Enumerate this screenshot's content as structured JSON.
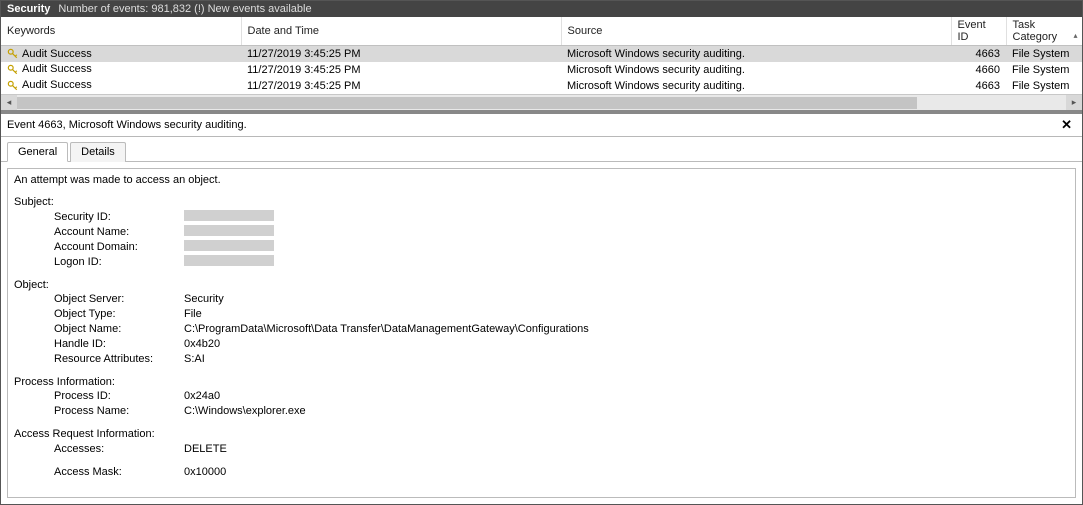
{
  "titlebar": {
    "section": "Security",
    "count_text": "Number of events: 981,832 (!) New events available"
  },
  "columns": {
    "keywords": "Keywords",
    "datetime": "Date and Time",
    "source": "Source",
    "eventid": "Event ID",
    "taskcat": "Task Category"
  },
  "events": [
    {
      "keywords": "Audit Success",
      "datetime": "11/27/2019 3:45:25 PM",
      "source": "Microsoft Windows security auditing.",
      "eventid": "4663",
      "taskcat": "File System",
      "selected": true
    },
    {
      "keywords": "Audit Success",
      "datetime": "11/27/2019 3:45:25 PM",
      "source": "Microsoft Windows security auditing.",
      "eventid": "4660",
      "taskcat": "File System",
      "selected": false
    },
    {
      "keywords": "Audit Success",
      "datetime": "11/27/2019 3:45:25 PM",
      "source": "Microsoft Windows security auditing.",
      "eventid": "4663",
      "taskcat": "File System",
      "selected": false
    }
  ],
  "detail": {
    "header": "Event 4663, Microsoft Windows security auditing.",
    "tabs": {
      "general": "General",
      "details": "Details"
    },
    "summary": "An attempt was made to access an object.",
    "sections": {
      "subject_title": "Subject:",
      "subject": {
        "security_id_k": "Security ID:",
        "account_name_k": "Account Name:",
        "account_domain_k": "Account Domain:",
        "logon_id_k": "Logon ID:"
      },
      "object_title": "Object:",
      "object": {
        "server_k": "Object Server:",
        "server_v": "Security",
        "type_k": "Object Type:",
        "type_v": "File",
        "name_k": "Object Name:",
        "name_v": "C:\\ProgramData\\Microsoft\\Data Transfer\\DataManagementGateway\\Configurations",
        "handle_k": "Handle ID:",
        "handle_v": "0x4b20",
        "resattr_k": "Resource Attributes:",
        "resattr_v": "S:AI"
      },
      "process_title": "Process Information:",
      "process": {
        "pid_k": "Process ID:",
        "pid_v": "0x24a0",
        "pname_k": "Process Name:",
        "pname_v": "C:\\Windows\\explorer.exe"
      },
      "access_title": "Access Request Information:",
      "access": {
        "accesses_k": "Accesses:",
        "accesses_v": "DELETE",
        "mask_k": "Access Mask:",
        "mask_v": "0x10000"
      }
    }
  }
}
